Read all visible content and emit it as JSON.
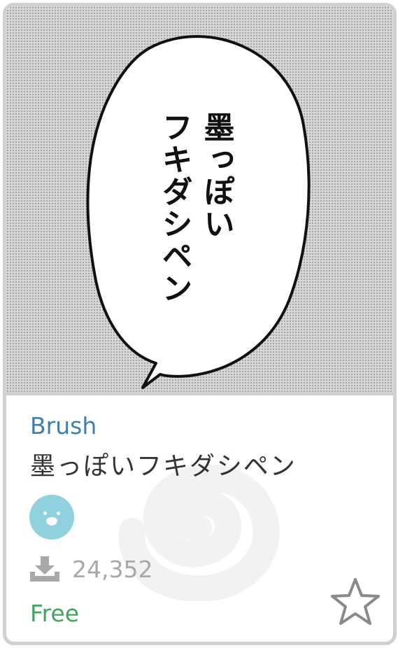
{
  "thumbnail": {
    "bubble_text": "墨っぽいフキダシペン"
  },
  "material": {
    "category": "Brush",
    "title": "墨っぽいフキダシペン",
    "downloads": "24,352",
    "price": "Free"
  },
  "icons": {
    "download": "download-icon",
    "favorite": "star-outline-icon",
    "watermark": "spiral-logo-icon",
    "avatar": "user-avatar"
  },
  "colors": {
    "category": "#3e7fb1",
    "price": "#3ea65e",
    "avatar": "#8fd1dc",
    "count": "#a8a8a8",
    "border": "#d0d0d0"
  }
}
